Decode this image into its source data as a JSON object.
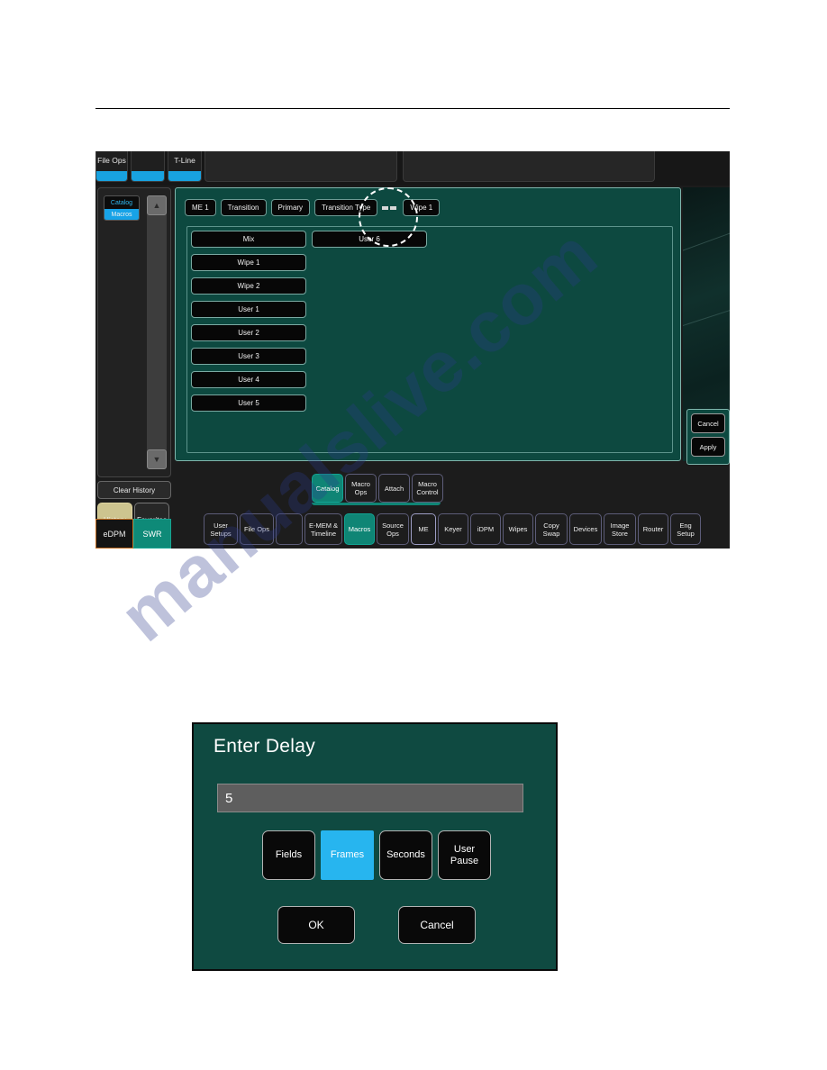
{
  "watermark": {
    "text": "manualslive.com"
  },
  "switcher": {
    "top_tabs": [
      {
        "label": "File Ops"
      },
      {
        "label": ""
      },
      {
        "label": "T-Line"
      }
    ],
    "history_panel": {
      "catalog_label": "Catalog",
      "macros_label": "Macros",
      "scroll_up_icon": "chevron-up-icon",
      "scroll_down_icon": "chevron-down-icon",
      "clear_history_label": "Clear History",
      "history_label": "History",
      "favorites_label": "Favorites",
      "edpm_label": "eDPM",
      "swr_label": "SWR"
    },
    "breadcrumb": [
      {
        "label": "ME 1"
      },
      {
        "label": "Transition"
      },
      {
        "label": "Primary"
      },
      {
        "label": "Transition Type"
      }
    ],
    "breadcrumb_value": {
      "label": "Wipe 1"
    },
    "menu_column_1": [
      {
        "label": "Mix"
      },
      {
        "label": "Wipe 1"
      },
      {
        "label": "Wipe 2"
      },
      {
        "label": "User 1"
      },
      {
        "label": "User 2"
      },
      {
        "label": "User 3"
      },
      {
        "label": "User 4"
      },
      {
        "label": "User 5"
      }
    ],
    "menu_column_2": [
      {
        "label": "User 6"
      }
    ],
    "side_actions": [
      {
        "label": "Cancel"
      },
      {
        "label": "Apply"
      }
    ],
    "sub_tools": [
      {
        "label": "Catalog",
        "selected": true
      },
      {
        "label": "Macro Ops",
        "selected": false
      },
      {
        "label": "Attach",
        "selected": false
      },
      {
        "label": "Macro Control",
        "selected": false
      }
    ],
    "app_buttons": [
      {
        "label": "User Setups",
        "selected": false,
        "width": 38
      },
      {
        "label": "File Ops",
        "selected": false,
        "width": 38
      },
      {
        "label": "",
        "selected": false,
        "width": 30
      },
      {
        "label": "E-MEM & Timeline",
        "selected": false,
        "width": 42
      },
      {
        "label": "Macros",
        "selected": true,
        "width": 34
      },
      {
        "label": "Source Ops",
        "selected": false,
        "width": 36
      },
      {
        "label": "ME",
        "selected": false,
        "width": 28
      },
      {
        "label": "Keyer",
        "selected": false,
        "width": 34
      },
      {
        "label": "iDPM",
        "selected": false,
        "width": 34
      },
      {
        "label": "Wipes",
        "selected": false,
        "width": 34
      },
      {
        "label": "Copy Swap",
        "selected": false,
        "width": 36
      },
      {
        "label": "Devices",
        "selected": false,
        "width": 36
      },
      {
        "label": "Image Store",
        "selected": false,
        "width": 36
      },
      {
        "label": "Router",
        "selected": false,
        "width": 34
      },
      {
        "label": "Eng Setup",
        "selected": false,
        "width": 34
      }
    ],
    "colors": {
      "panel_teal": "#0d4940",
      "accent_cyan": "#18a2e0",
      "selected_teal": "#0f8575",
      "history_tan": "#cdc48f",
      "edpm_orange": "#c06a1e"
    }
  },
  "dialog": {
    "title": "Enter Delay",
    "input_value": "5",
    "input_placeholder": "",
    "units": [
      {
        "label": "Fields",
        "selected": false
      },
      {
        "label": "Frames",
        "selected": true
      },
      {
        "label": "Seconds",
        "selected": false
      },
      {
        "label": "User Pause",
        "selected": false
      }
    ],
    "ok_label": "OK",
    "cancel_label": "Cancel",
    "colors": {
      "background": "#0f4a41",
      "selected_blue": "#27b5ef",
      "input_grey": "#5e5e5e"
    }
  }
}
